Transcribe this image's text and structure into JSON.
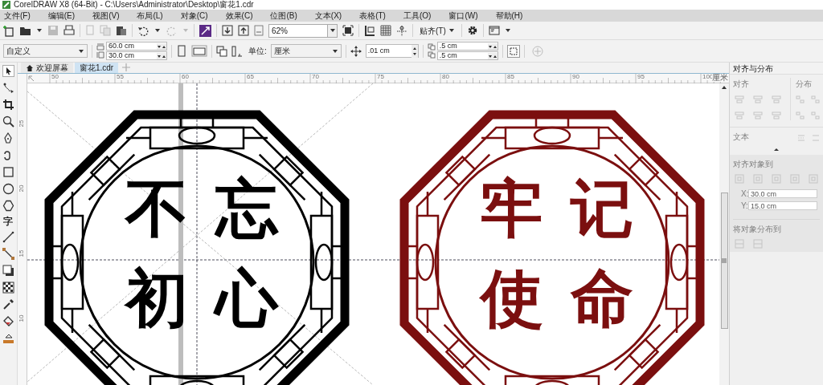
{
  "window": {
    "title": "CorelDRAW X8 (64-Bit) - C:\\Users\\Administrator\\Desktop\\窗花1.cdr"
  },
  "menu": [
    "文件(F)",
    "编辑(E)",
    "视图(V)",
    "布局(L)",
    "对象(C)",
    "效果(C)",
    "位图(B)",
    "文本(X)",
    "表格(T)",
    "工具(O)",
    "窗口(W)",
    "帮助(H)"
  ],
  "standard_toolbar": {
    "zoom": "62%",
    "snap": "贴齐(T)"
  },
  "property_bar": {
    "page_size": "自定义",
    "width": "60.0 cm",
    "height": "30.0 cm",
    "unit_label": "单位:",
    "unit": "厘米",
    "nudge": ".01 cm",
    "dup_x": ".5 cm",
    "dup_y": ".5 cm"
  },
  "tabs": [
    {
      "label": "欢迎屏幕",
      "selected": false
    },
    {
      "label": "窗花1.cdr",
      "selected": true
    }
  ],
  "toolbox": {
    "text_tool": "字"
  },
  "rulers": {
    "horizontal": [
      "50",
      "55",
      "60",
      "65",
      "70",
      "75",
      "80",
      "85",
      "90",
      "95",
      "100"
    ],
    "vertical": [
      "25",
      "20",
      "15",
      "10"
    ],
    "unit": "厘米"
  },
  "artworks": [
    {
      "color": "#000000",
      "characters": [
        "不",
        "忘",
        "初",
        "心"
      ]
    },
    {
      "color": "#7b0f0f",
      "characters": [
        "牢",
        "记",
        "使",
        "命"
      ]
    }
  ],
  "panel": {
    "title": "对齐与分布",
    "disabled": true,
    "align_label": "对齐",
    "distribute_label": "分布",
    "text_label": "文本",
    "align_to_label": "对齐对象到",
    "x_label": "X:",
    "x": "30.0 cm",
    "y_label": "Y:",
    "y": "15.0 cm",
    "distribute_to_label": "将对象分布到"
  }
}
